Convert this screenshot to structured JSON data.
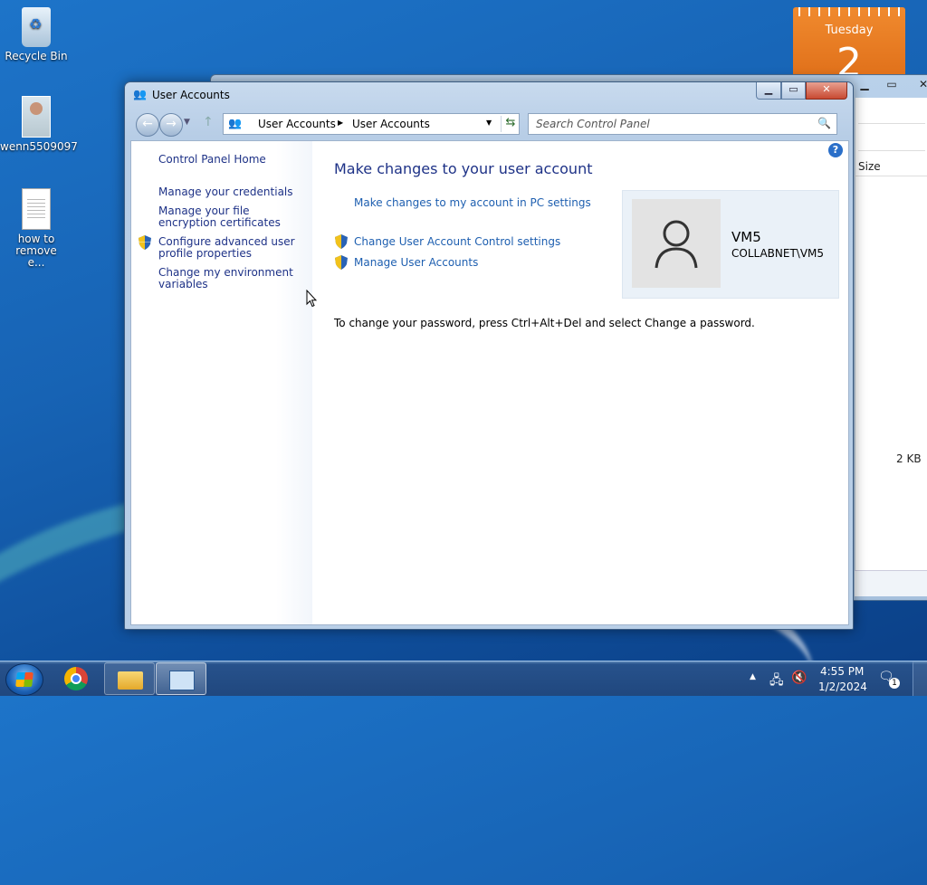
{
  "desktop": {
    "icons": [
      {
        "label": "Recycle Bin",
        "icon": "recycle-bin-icon"
      },
      {
        "label": "wenn5509097",
        "icon": "image-file-icon"
      },
      {
        "label": "how to remove e...",
        "icon": "text-document-icon"
      }
    ],
    "calendar": {
      "day": "Tuesday",
      "date": "2"
    }
  },
  "background_window": {
    "column_header": "Size",
    "file_size": "2 KB"
  },
  "window": {
    "title": "User Accounts",
    "breadcrumb": [
      "User Accounts",
      "User Accounts"
    ],
    "search_placeholder": "Search Control Panel",
    "help_glyph": "?"
  },
  "sidebar": {
    "links": [
      {
        "label": "Control Panel Home",
        "shield": false
      },
      {
        "label": "Manage your credentials",
        "shield": false
      },
      {
        "label": "Manage your file encryption certificates",
        "shield": false
      },
      {
        "label": "Configure advanced user profile properties",
        "shield": true
      },
      {
        "label": "Change my environment variables",
        "shield": false
      }
    ]
  },
  "main": {
    "heading": "Make changes to your user account",
    "links": [
      {
        "label": "Make changes to my account in PC settings",
        "shield": false
      },
      {
        "label": "Change User Account Control settings",
        "shield": true
      },
      {
        "label": "Manage User Accounts",
        "shield": true
      }
    ],
    "info": "To change your password, press Ctrl+Alt+Del and select Change a password."
  },
  "user": {
    "name": "VM5",
    "domain": "COLLABNET\\VM5"
  },
  "taskbar": {
    "clock_time": "4:55 PM",
    "clock_date": "1/2/2024",
    "notification_count": "1"
  },
  "colors": {
    "link": "#1e5fb0",
    "heading": "#1e3287",
    "desktop": "#1763b4"
  }
}
